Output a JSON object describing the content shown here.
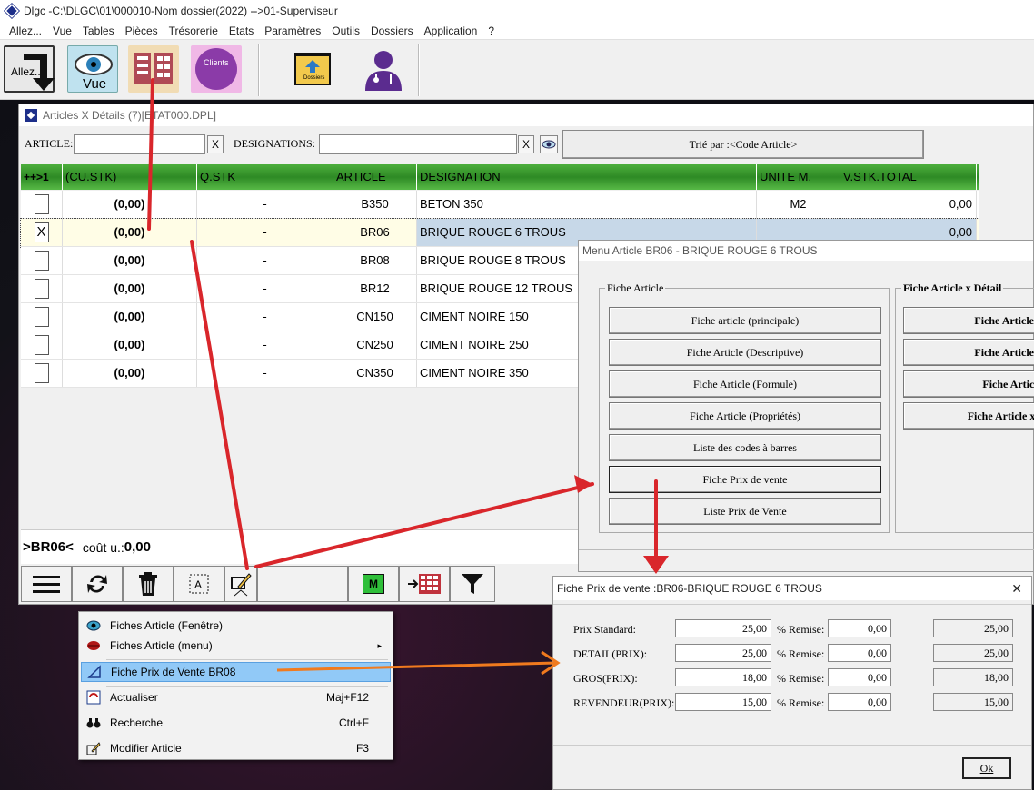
{
  "app": {
    "title": "Dlgc -C:\\DLGC\\01\\000010-Nom dossier(2022) -->01-Superviseur"
  },
  "menubar": [
    "Allez...",
    "Vue",
    "Tables",
    "Pièces",
    "Trésorerie",
    "Etats",
    "Paramètres",
    "Outils",
    "Dossiers",
    "Application",
    "?"
  ],
  "toolbar": {
    "allez_label": "Allez...",
    "vue_label": "Vue",
    "clients_label": "Clients",
    "dossiers_label": "Dossiers"
  },
  "articles_window": {
    "title": "Articles X Détails (7)[ETAT000.DPL]",
    "article_label": "ARTICLE:",
    "article_value": "",
    "clear1": "X",
    "designations_label": "DESIGNATIONS:",
    "designations_value": "",
    "clear2": "X",
    "sort_button": "Trié par :<Code Article>",
    "columns": [
      "++>1",
      "(CU.STK)",
      "Q.STK",
      "ARTICLE",
      "DESIGNATION",
      "UNITE M.",
      "V.STK.TOTAL"
    ],
    "rows": [
      {
        "check": "",
        "cu": "(0,00)",
        "q": "-",
        "article": "B350",
        "designation": "BETON 350",
        "unite": "M2",
        "total": "0,00"
      },
      {
        "check": "X",
        "cu": "(0,00)",
        "q": "-",
        "article": "BR06",
        "designation": "BRIQUE ROUGE 6 TROUS",
        "unite": "",
        "total": "0,00"
      },
      {
        "check": "",
        "cu": "(0,00)",
        "q": "-",
        "article": "BR08",
        "designation": "BRIQUE ROUGE 8 TROUS",
        "unite": "",
        "total": ""
      },
      {
        "check": "",
        "cu": "(0,00)",
        "q": "-",
        "article": "BR12",
        "designation": "BRIQUE ROUGE 12 TROUS",
        "unite": "",
        "total": ""
      },
      {
        "check": "",
        "cu": "(0,00)",
        "q": "-",
        "article": "CN150",
        "designation": "CIMENT NOIRE 150",
        "unite": "",
        "total": ""
      },
      {
        "check": "",
        "cu": "(0,00)",
        "q": "-",
        "article": "CN250",
        "designation": "CIMENT NOIRE 250",
        "unite": "",
        "total": ""
      },
      {
        "check": "",
        "cu": "(0,00)",
        "q": "-",
        "article": "CN350",
        "designation": "CIMENT NOIRE 350",
        "unite": "",
        "total": ""
      }
    ],
    "status_code": ">BR06<",
    "status_cost_label": "coût u.:",
    "status_cost_value": "0,00",
    "m_label": "M"
  },
  "context_menu": [
    {
      "label": "Fiches Article (Fenêtre)",
      "shortcut": ""
    },
    {
      "label": "Fiches Article (menu)",
      "shortcut": "▸"
    },
    {
      "label": "Fiche Prix de Vente BR08",
      "shortcut": ""
    },
    {
      "label": "Actualiser",
      "shortcut": "Maj+F12"
    },
    {
      "label": "Recherche",
      "shortcut": "Ctrl+F"
    },
    {
      "label": "Modifier Article",
      "shortcut": "F3"
    }
  ],
  "menu_article": {
    "title": "Menu Article BR06 - BRIQUE ROUGE 6 TROUS",
    "group1": "Fiche Article",
    "buttons": [
      "Fiche article (principale)",
      "Fiche Article (Descriptive)",
      "Fiche Article (Formule)",
      "Fiche Article (Propriétés)",
      "Liste des codes à barres",
      "Fiche Prix de vente",
      "Liste Prix de Vente"
    ],
    "group2": "Fiche Article x Détail",
    "buttons2": [
      "Fiche Article x",
      "Fiche Article x",
      "Fiche Article",
      "Fiche Article x I"
    ]
  },
  "prix_window": {
    "title": "Fiche Prix de vente :BR06-BRIQUE ROUGE 6 TROUS",
    "close": "✕",
    "remise_label": "% Remise:",
    "rows": [
      {
        "label": "Prix Standard:",
        "price": "25,00",
        "remise": "0,00",
        "result": "25,00"
      },
      {
        "label": "DETAIL(PRIX):",
        "price": "25,00",
        "remise": "0,00",
        "result": "25,00"
      },
      {
        "label": "GROS(PRIX):",
        "price": "18,00",
        "remise": "0,00",
        "result": "18,00"
      },
      {
        "label": "REVENDEUR(PRIX):",
        "price": "15,00",
        "remise": "0,00",
        "result": "15,00"
      }
    ],
    "ok": "Ok"
  },
  "colors": {
    "grid_header": "#3a9a2e",
    "selection": "#91c9f7",
    "arrow_red": "#d9262b",
    "arrow_orange": "#f07a1e"
  }
}
